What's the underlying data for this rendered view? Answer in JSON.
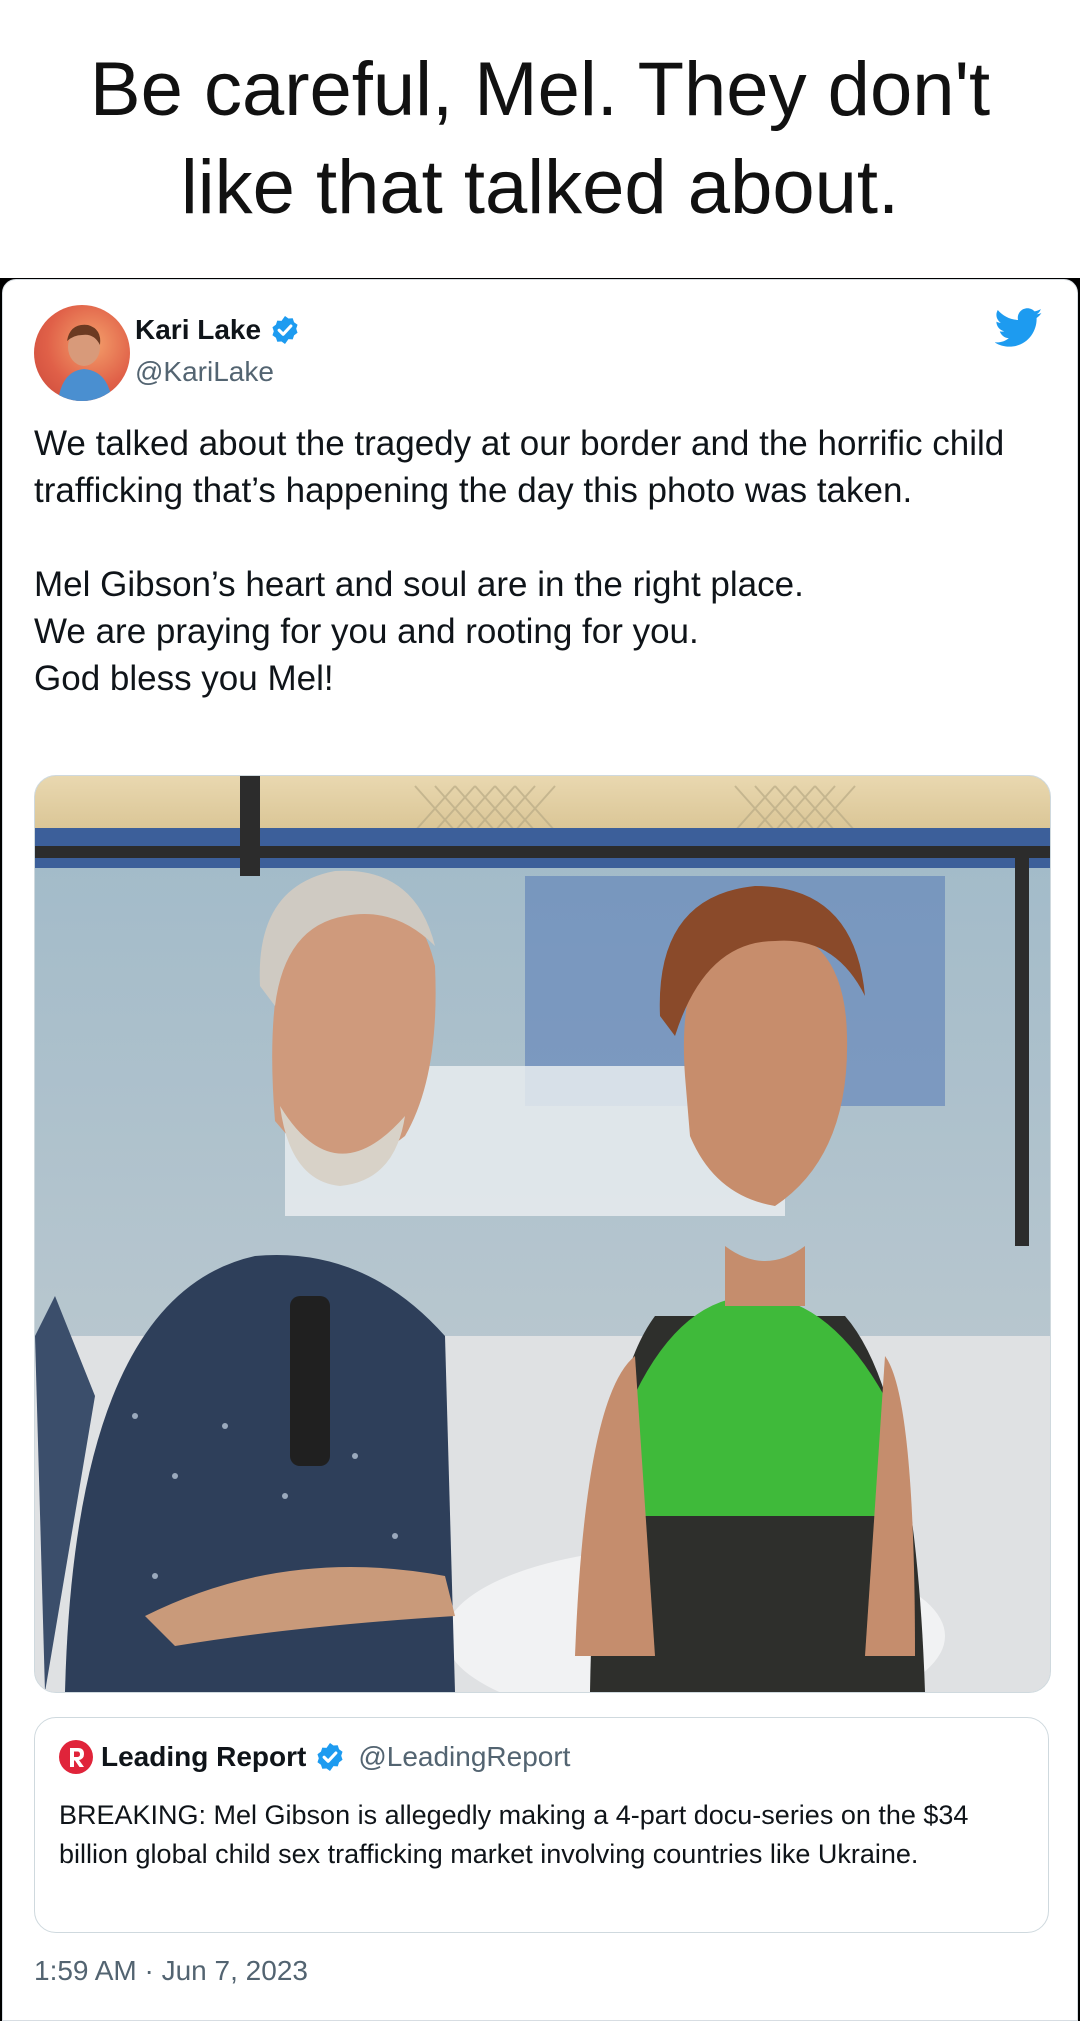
{
  "meme": {
    "caption": "Be careful, Mel. They don't\nlike that talked about."
  },
  "tweet": {
    "author_name": "Kari Lake",
    "author_handle": "@KariLake",
    "paragraph_1": "We talked about the tragedy at our border and the horrific child trafficking that’s happening the day this photo was taken.",
    "paragraph_2_lines": [
      "Mel Gibson’s heart and soul are in the right place.",
      "We are praying for you and rooting for you.",
      "God bless you Mel!"
    ],
    "timestamp": "1:59 AM · Jun 7, 2023"
  },
  "quoted_tweet": {
    "author_name": "Leading Report",
    "author_handle": "@LeadingReport",
    "text": "BREAKING: Mel Gibson is allegedly making a 4-part docu-series on the $34 billion global child sex trafficking market involving countries like Ukraine."
  },
  "colors": {
    "twitter_blue": "#1d9bf0",
    "text_primary": "#0f1419",
    "text_secondary": "#536471",
    "leading_report_red": "#e0243a"
  },
  "icons": {
    "verified": "verified-badge-icon",
    "twitter": "twitter-bird-icon",
    "leading_report": "leading-report-logo-icon"
  }
}
